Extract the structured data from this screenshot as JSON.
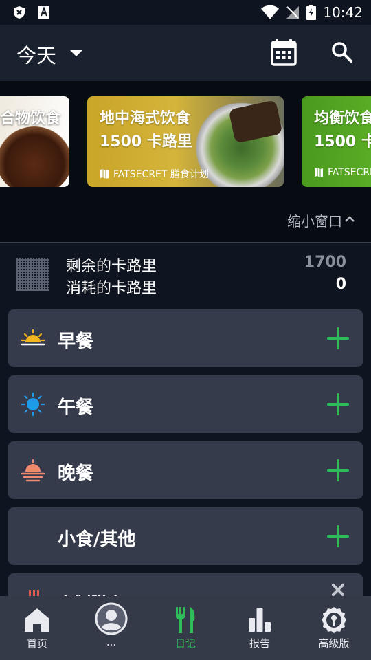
{
  "status_bar": {
    "time": "10:42"
  },
  "header": {
    "title": "今天"
  },
  "carousel": [
    {
      "title": "合物饮食",
      "subtitle": "",
      "tag": ""
    },
    {
      "title": "地中海式饮食",
      "subtitle": "1500 卡路里",
      "tag": "FATSECRET 膳食计划"
    },
    {
      "title": "均衡饮食",
      "subtitle": "1500 卡",
      "tag": "FATSECRE"
    }
  ],
  "collapse": {
    "label": "缩小窗口"
  },
  "summary": {
    "remaining_label": "剩余的卡路里",
    "remaining_value": "1700",
    "burned_label": "消耗的卡路里",
    "burned_value": "0"
  },
  "meals": [
    {
      "label": "早餐",
      "icon": "sunrise-icon"
    },
    {
      "label": "午餐",
      "icon": "sun-icon"
    },
    {
      "label": "晚餐",
      "icon": "sunset-icon"
    },
    {
      "label": "小食/其他",
      "icon": "moon-icon"
    }
  ],
  "custom_card": {
    "title": "定制膳食"
  },
  "nav": [
    {
      "label": "首页",
      "icon": "home-icon"
    },
    {
      "label": "...",
      "icon": "profile-icon"
    },
    {
      "label": "日记",
      "icon": "fork-knife-icon"
    },
    {
      "label": "报告",
      "icon": "bar-chart-icon"
    },
    {
      "label": "高级版",
      "icon": "premium-icon"
    }
  ],
  "colors": {
    "accent_green": "#2ebd59",
    "card_bg": "#363b4c",
    "app_bar": "#1a2230",
    "background": "#0f1520"
  }
}
